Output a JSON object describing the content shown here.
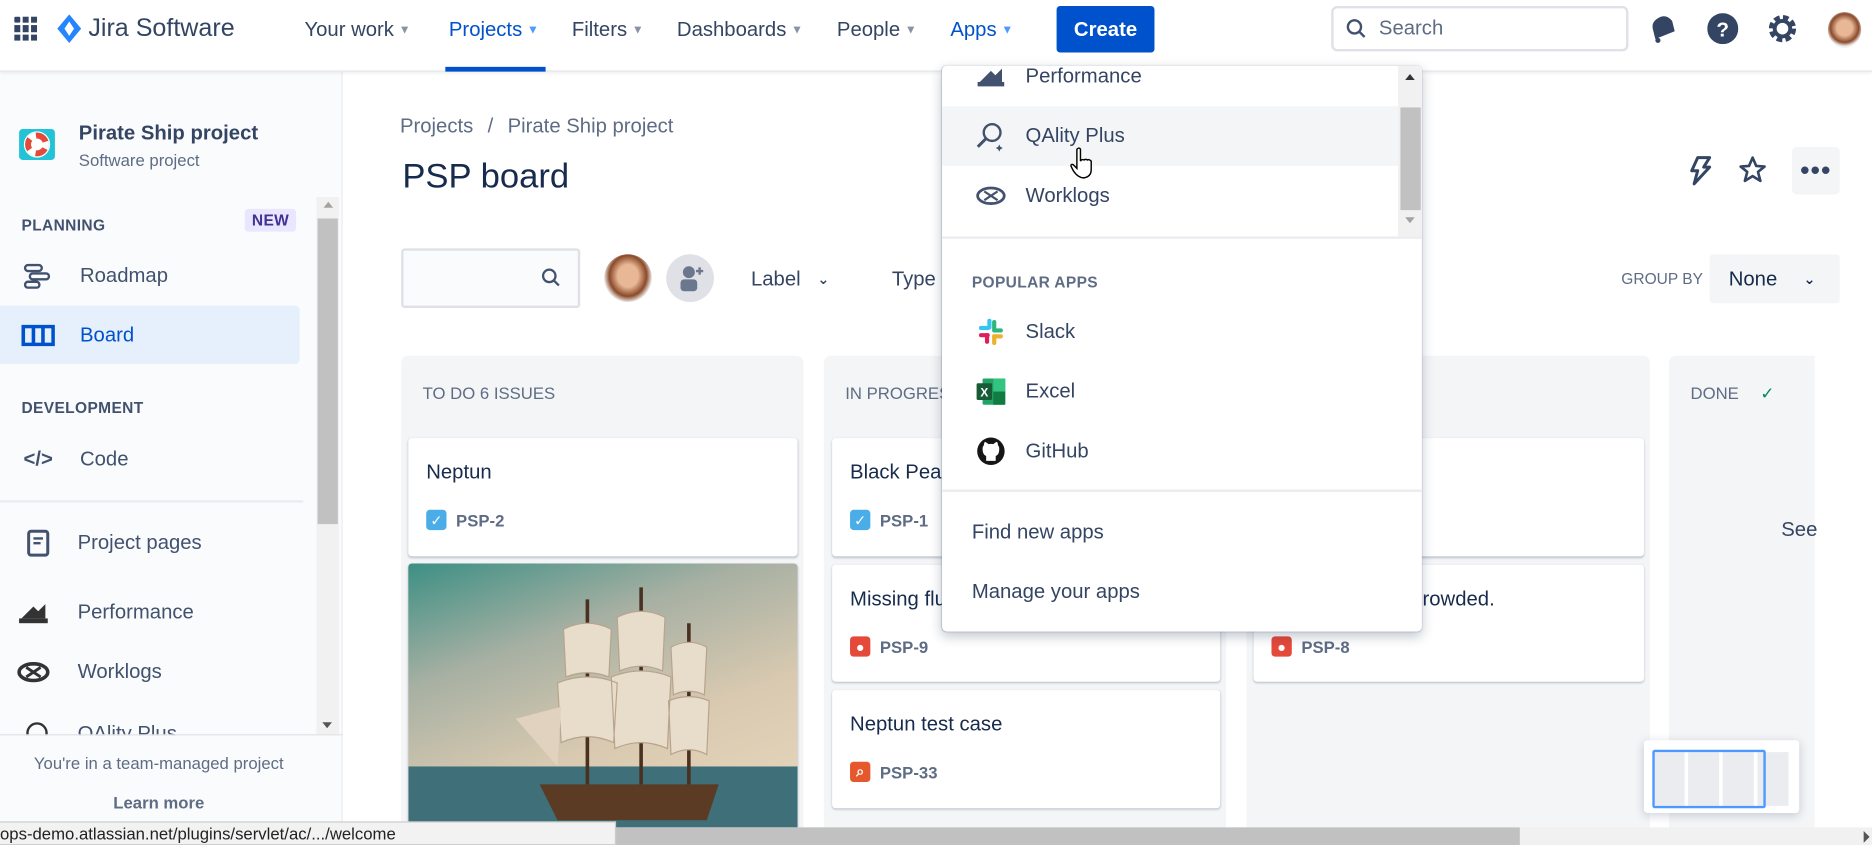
{
  "topbar": {
    "product": "Jira Software",
    "nav": [
      {
        "label": "Your work"
      },
      {
        "label": "Projects",
        "active": true
      },
      {
        "label": "Filters"
      },
      {
        "label": "Dashboards"
      },
      {
        "label": "People"
      },
      {
        "label": "Apps",
        "active": true
      }
    ],
    "create": "Create",
    "search_placeholder": "Search"
  },
  "sidebar": {
    "project_name": "Pirate Ship project",
    "project_type": "Software project",
    "planning": "PLANNING",
    "new_badge": "NEW",
    "roadmap": "Roadmap",
    "board": "Board",
    "development": "DEVELOPMENT",
    "code": "Code",
    "project_pages": "Project pages",
    "performance": "Performance",
    "worklogs": "Worklogs",
    "qality": "QAlity Plus",
    "footer_text": "You're in a team-managed project",
    "learn_more": "Learn more"
  },
  "main": {
    "breadcrumb": [
      "Projects",
      "/",
      "Pirate Ship project"
    ],
    "title": "PSP board",
    "filters": {
      "label": "Label",
      "type": "Type",
      "group_by": "GROUP BY",
      "group_value": "None"
    },
    "columns": [
      {
        "title": "TO DO 6 ISSUES",
        "cards": [
          {
            "title": "Neptun",
            "key": "PSP-2",
            "type": "task"
          }
        ]
      },
      {
        "title": "IN PROGRESS",
        "cards": [
          {
            "title": "Black Pearl",
            "key": "PSP-1",
            "type": "task"
          },
          {
            "title": "Missing flu",
            "key": "PSP-9",
            "type": "bug"
          },
          {
            "title": "Neptun test case",
            "key": "PSP-33",
            "type": "test"
          }
        ]
      },
      {
        "title": "",
        "cards": [
          {
            "title": "",
            "key": "",
            "type": ""
          },
          {
            "title": "crowded.",
            "key": "PSP-8",
            "type": "bug"
          }
        ]
      },
      {
        "title": "DONE",
        "done_check": "✓",
        "see": "See"
      }
    ]
  },
  "apps_menu": {
    "items": [
      "Performance",
      "QAlity Plus",
      "Worklogs"
    ],
    "popular_heading": "POPULAR APPS",
    "popular": [
      "Slack",
      "Excel",
      "GitHub"
    ],
    "find": "Find new apps",
    "manage": "Manage your apps"
  },
  "status_url": "ops-demo.atlassian.net/plugins/servlet/ac/.../welcome",
  "colors": {
    "brand": "#0052cc",
    "selected_bg": "#e6effc",
    "bug": "#e5493a",
    "task": "#4bade8",
    "test": "#e5582b"
  }
}
